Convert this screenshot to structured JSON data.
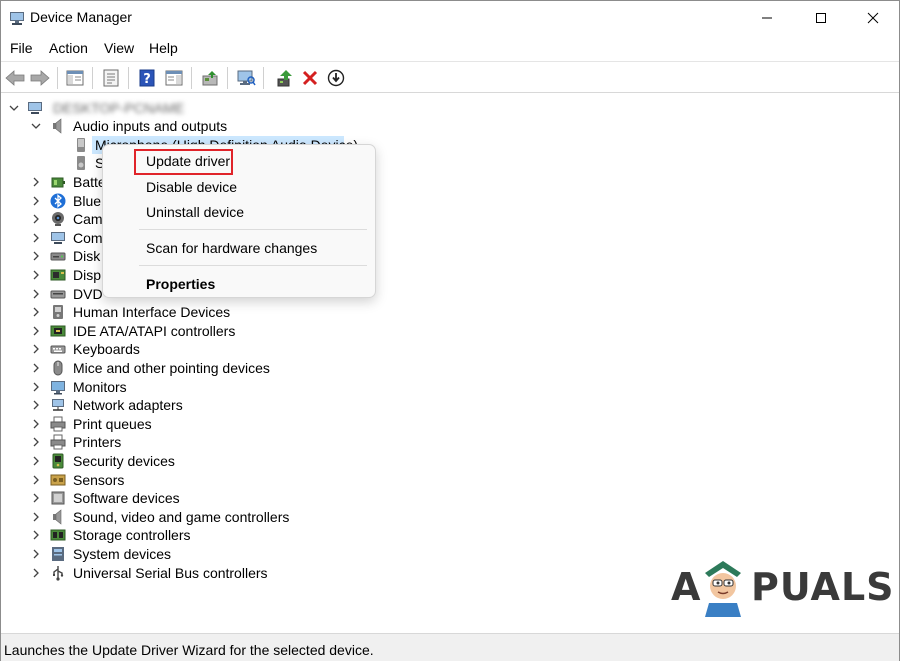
{
  "window": {
    "title": "Device Manager"
  },
  "menu": {
    "file": "File",
    "action": "Action",
    "view": "View",
    "help": "Help"
  },
  "toolbar": {
    "icons": [
      "back-arrow-icon",
      "forward-arrow-icon",
      "show-hide-console-tree-icon",
      "properties-icon",
      "help-icon",
      "action-pane-icon",
      "update-driver-software-icon",
      "scan-hardware-icon",
      "enable-device-icon",
      "uninstall-device-icon",
      "download-driver-icon"
    ]
  },
  "tree": {
    "root": {
      "label": "DESKTOP-PCNAME"
    },
    "audio": {
      "label": "Audio inputs and outputs"
    },
    "audio_children": [
      {
        "label": "Microphone (High Definition Audio Device)"
      },
      {
        "label": "S"
      }
    ],
    "categories": [
      {
        "label": "Batte",
        "icon": "battery-icon"
      },
      {
        "label": "Blue",
        "icon": "bluetooth-icon"
      },
      {
        "label": "Cam",
        "icon": "camera-icon"
      },
      {
        "label": "Com",
        "icon": "computer-icon"
      },
      {
        "label": "Disk",
        "icon": "disk-drive-icon"
      },
      {
        "label": "Disp",
        "icon": "display-adapter-icon"
      },
      {
        "label": "DVD",
        "icon": "dvd-drive-icon"
      },
      {
        "label": "Human Interface Devices",
        "icon": "hid-icon"
      },
      {
        "label": "IDE ATA/ATAPI controllers",
        "icon": "ide-controller-icon"
      },
      {
        "label": "Keyboards",
        "icon": "keyboard-icon"
      },
      {
        "label": "Mice and other pointing devices",
        "icon": "mouse-icon"
      },
      {
        "label": "Monitors",
        "icon": "monitor-icon"
      },
      {
        "label": "Network adapters",
        "icon": "network-adapter-icon"
      },
      {
        "label": "Print queues",
        "icon": "print-queue-icon"
      },
      {
        "label": "Printers",
        "icon": "printer-icon"
      },
      {
        "label": "Security devices",
        "icon": "security-device-icon"
      },
      {
        "label": "Sensors",
        "icon": "sensor-icon"
      },
      {
        "label": "Software devices",
        "icon": "software-device-icon"
      },
      {
        "label": "Sound, video and game controllers",
        "icon": "sound-controller-icon"
      },
      {
        "label": "Storage controllers",
        "icon": "storage-controller-icon"
      },
      {
        "label": "System devices",
        "icon": "system-device-icon"
      },
      {
        "label": "Universal Serial Bus controllers",
        "icon": "usb-controller-icon"
      }
    ]
  },
  "context_menu": {
    "update_driver": "Update driver",
    "disable_device": "Disable device",
    "uninstall_device": "Uninstall device",
    "scan": "Scan for hardware changes",
    "properties": "Properties"
  },
  "status": {
    "text": "Launches the Update Driver Wizard for the selected device."
  },
  "watermark": {
    "text_a": "A",
    "text_rest": "PUALS"
  },
  "colors": {
    "selection": "#cce8ff",
    "highlight_border": "#e0242a",
    "accent_blue": "#1f5fbf",
    "uninstall_red": "#d42020"
  }
}
